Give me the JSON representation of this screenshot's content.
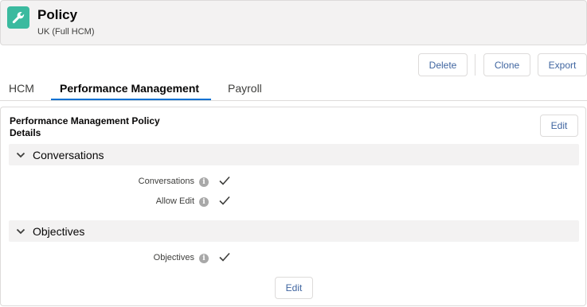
{
  "header": {
    "title": "Policy",
    "subtitle": "UK (Full HCM)",
    "icon": "wrench-icon",
    "icon_color": "#3bba9f"
  },
  "actions": {
    "delete_label": "Delete",
    "clone_label": "Clone",
    "export_label": "Export"
  },
  "tabs": [
    {
      "label": "HCM",
      "active": false
    },
    {
      "label": "Performance Management",
      "active": true
    },
    {
      "label": "Payroll",
      "active": false
    }
  ],
  "card": {
    "title": "Performance Management Policy Details",
    "edit_label": "Edit",
    "footer_edit_label": "Edit",
    "sections": [
      {
        "label": "Conversations",
        "fields": [
          {
            "label": "Conversations",
            "value": true
          },
          {
            "label": "Allow Edit",
            "value": true
          }
        ]
      },
      {
        "label": "Objectives",
        "fields": [
          {
            "label": "Objectives",
            "value": true
          }
        ]
      }
    ]
  },
  "colors": {
    "accent": "#0070d2",
    "button_text": "#3f65a0"
  }
}
